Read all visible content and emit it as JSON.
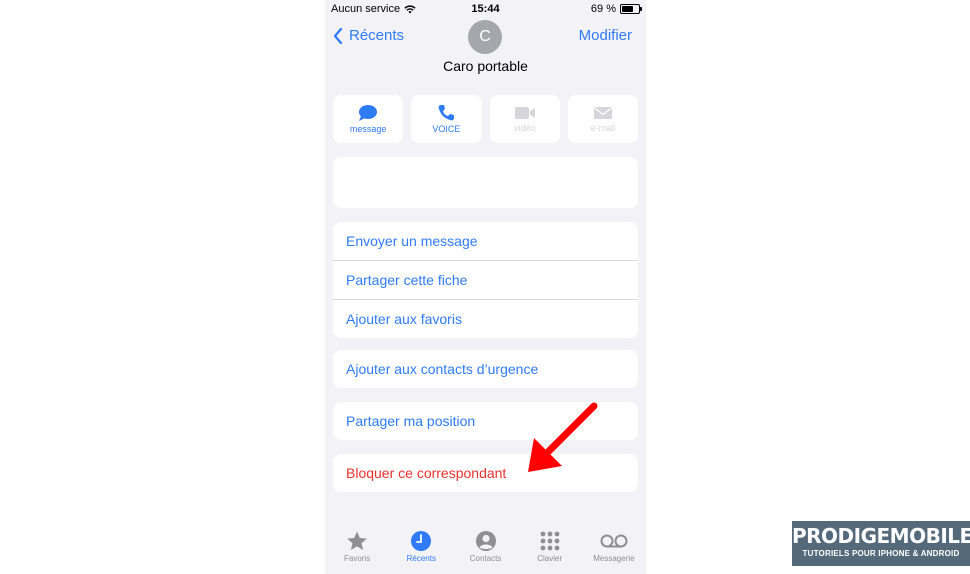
{
  "status_bar": {
    "carrier": "Aucun service",
    "time": "15:44",
    "battery_pct": "69 %",
    "battery_level": 0.69
  },
  "nav": {
    "back_label": "Récents",
    "avatar_initial": "C",
    "edit_label": "Modifier",
    "contact_name": "Caro portable"
  },
  "actions": [
    {
      "label": "message",
      "icon": "message-bubble-icon",
      "enabled": true
    },
    {
      "label": "VOICE",
      "icon": "phone-icon",
      "enabled": true
    },
    {
      "label": "vidéo",
      "icon": "video-camera-icon",
      "enabled": false
    },
    {
      "label": "e-mail",
      "icon": "envelope-icon",
      "enabled": false
    }
  ],
  "options": {
    "group1": [
      "Envoyer un message",
      "Partager cette fiche",
      "Ajouter aux favoris"
    ],
    "emergency": "Ajouter aux contacts d’urgence",
    "share_location": "Partager ma position",
    "block": "Bloquer ce correspondant"
  },
  "tabbar": [
    {
      "label": "Favoris",
      "icon": "star-icon",
      "active": false
    },
    {
      "label": "Récents",
      "icon": "clock-icon",
      "active": true
    },
    {
      "label": "Contacts",
      "icon": "person-icon",
      "active": false
    },
    {
      "label": "Clavier",
      "icon": "keypad-icon",
      "active": false
    },
    {
      "label": "Messagerie",
      "icon": "voicemail-icon",
      "active": false
    }
  ],
  "watermark": {
    "brand": "PRODIGEMOBILE",
    "tagline": "TUTORIELS POUR IPHONE & ANDROID"
  },
  "colors": {
    "accent": "#2f7bf5",
    "danger": "#e8322d",
    "arrow": "#ff0000",
    "background": "#f2f2f7",
    "brand_bg": "#546a7b"
  }
}
